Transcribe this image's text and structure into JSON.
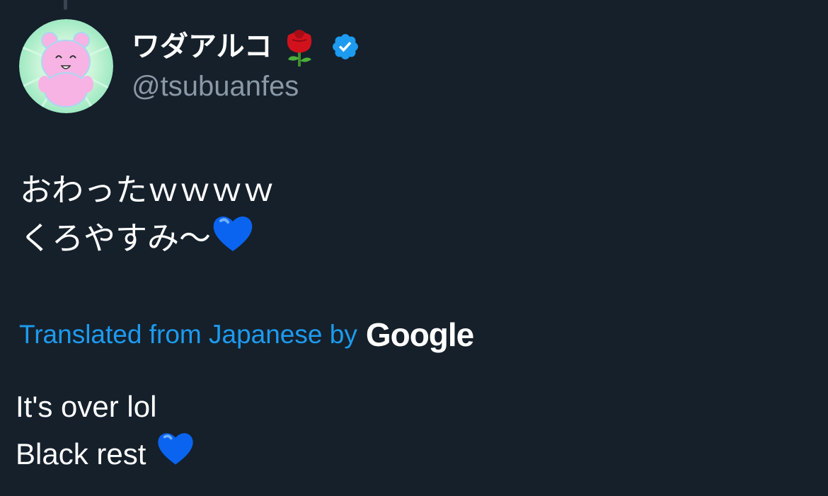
{
  "author": {
    "display_name": "ワダアルコ",
    "display_name_emoji": "rose-icon",
    "verified": true,
    "verified_icon": "verified-badge-icon",
    "verified_color": "#1d9bf0",
    "handle": "@tsubuanfes",
    "avatar": "pink-bear-avatar"
  },
  "tweet": {
    "lines": [
      "おわったｗｗｗｗ",
      "くろやすみ〜"
    ],
    "line2_emoji": "blue-heart-icon"
  },
  "translation": {
    "label": "Translated from Japanese by",
    "provider": "Google",
    "lines": [
      "It's over lol",
      "Black rest"
    ],
    "line2_emoji": "blue-heart-icon"
  },
  "colors": {
    "background": "#15202b",
    "text": "#ffffff",
    "secondary_text": "#8b98a5",
    "accent": "#1d9bf0"
  }
}
